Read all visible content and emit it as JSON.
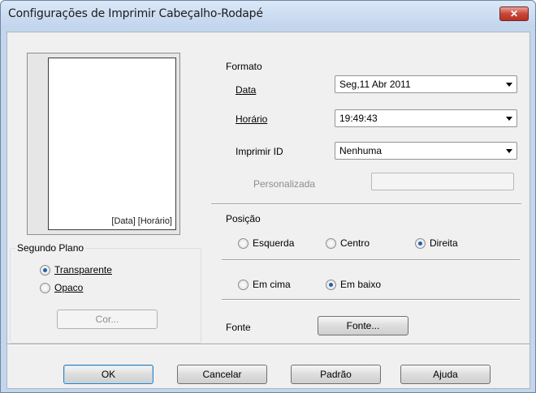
{
  "window": {
    "title": "Configurações de Imprimir Cabeçalho-Rodapé",
    "close_symbol": "✕"
  },
  "preview": {
    "label": "[Data] [Horário]"
  },
  "background": {
    "legend": "Segundo Plano",
    "transparent_label": "Transparente",
    "opaque_label": "Opaco",
    "color_button": "Cor..."
  },
  "format": {
    "heading": "Formato",
    "date_label": "Data",
    "date_value": "Seg,11 Abr 2011",
    "time_label": "Horário",
    "time_value": "19:49:43",
    "print_id_label": "Imprimir ID",
    "print_id_value": "Nenhuma",
    "custom_label": "Personalizada",
    "custom_value": ""
  },
  "position": {
    "heading": "Posição",
    "left": "Esquerda",
    "center": "Centro",
    "right": "Direita",
    "top": "Em cima",
    "bottom": "Em baixo",
    "selected_horizontal": "Direita",
    "selected_vertical": "Em baixo"
  },
  "font": {
    "label": "Fonte",
    "button": "Fonte..."
  },
  "buttons": {
    "ok": "OK",
    "cancel": "Cancelar",
    "default": "Padrão",
    "help": "Ajuda"
  }
}
